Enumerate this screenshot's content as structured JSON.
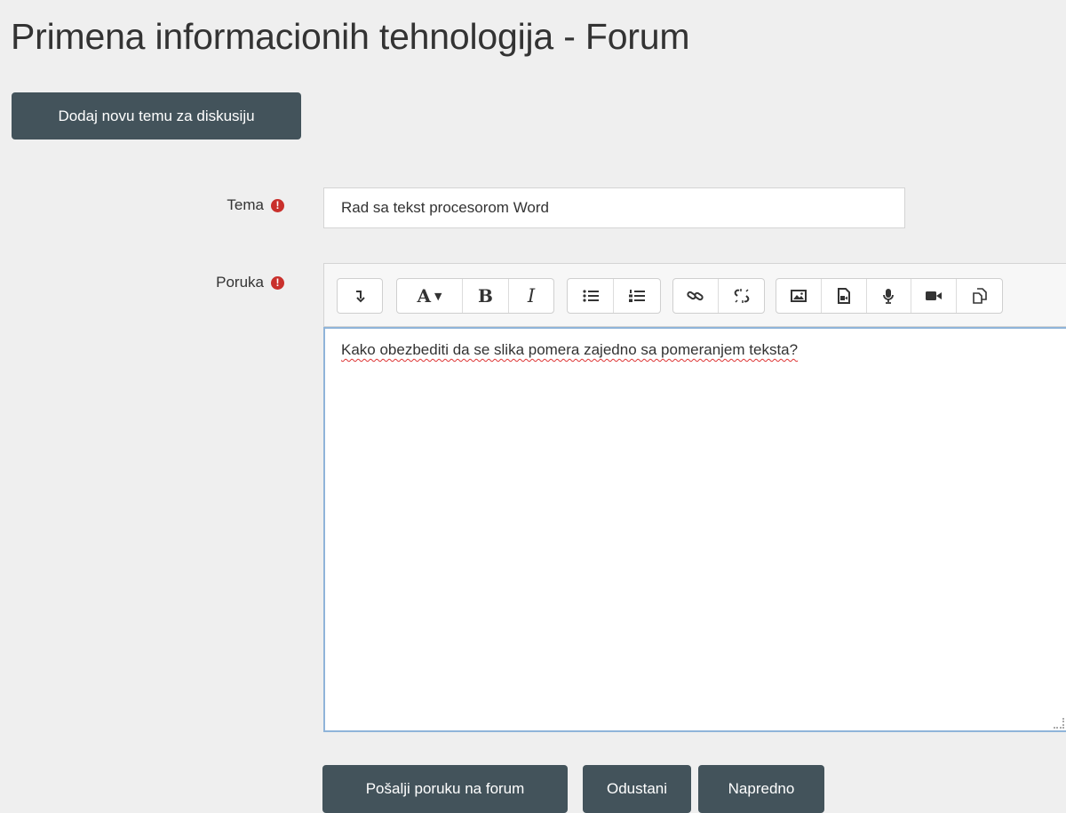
{
  "page": {
    "title": "Primena informacionih tehnologija - Forum"
  },
  "actions": {
    "add_topic_label": "Dodaj novu temu za diskusiju"
  },
  "form": {
    "subject": {
      "label": "Tema",
      "value": "Rad sa tekst procesorom Word",
      "required_icon": "exclamation-circle-icon"
    },
    "message": {
      "label": "Poruka",
      "required_icon": "exclamation-circle-icon",
      "content": "Kako obezbediti da se slika pomera zajedno sa pomeranjem teksta?"
    },
    "toolbar": {
      "icons": [
        "expand-toolbar-icon",
        "font-style-icon",
        "bold-icon",
        "italic-icon",
        "unordered-list-icon",
        "ordered-list-icon",
        "link-icon",
        "unlink-icon",
        "image-icon",
        "media-icon",
        "audio-record-icon",
        "video-record-icon",
        "manage-files-icon"
      ]
    },
    "buttons": {
      "submit_label": "Pošalji poruku na forum",
      "cancel_label": "Odustani",
      "advanced_label": "Napredno"
    }
  },
  "colors": {
    "background": "#efefef",
    "button": "#43535b",
    "required": "#c9302c",
    "editor_focus_border": "#8fb4d9"
  }
}
